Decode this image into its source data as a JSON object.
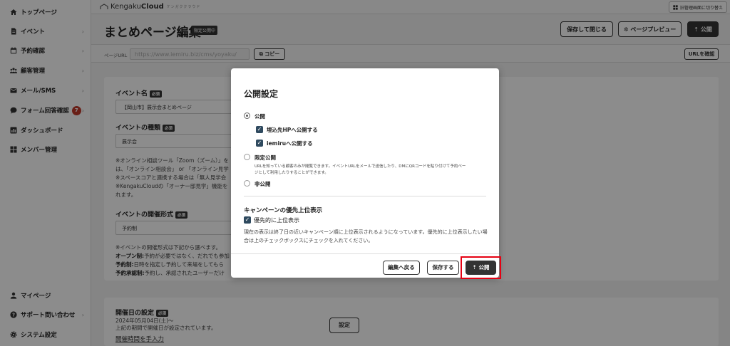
{
  "sidebar": {
    "items": [
      {
        "label": "トップページ",
        "icon": "home-icon",
        "chevron": ""
      },
      {
        "label": "イベント",
        "icon": "document-icon",
        "chevron": "›"
      },
      {
        "label": "予約確認",
        "icon": "calendar-icon",
        "chevron": "›"
      },
      {
        "label": "顧客管理",
        "icon": "people-icon",
        "chevron": "›"
      },
      {
        "label": "メール/SMS",
        "icon": "mail-icon",
        "chevron": "›"
      },
      {
        "label": "フォーム回答確認",
        "icon": "chat-icon",
        "chevron": "›",
        "badge": "7"
      },
      {
        "label": "ダッシュボード",
        "icon": "chart-icon",
        "chevron": ""
      },
      {
        "label": "メンバー管理",
        "icon": "grid-icon",
        "chevron": ""
      }
    ],
    "bottom_items": [
      {
        "label": "マイページ",
        "icon": "user-icon",
        "chevron": ""
      },
      {
        "label": "サポート問い合わせ",
        "icon": "help-icon",
        "chevron": "›"
      },
      {
        "label": "システム設定",
        "icon": "gear-icon",
        "chevron": ""
      }
    ]
  },
  "header": {
    "logo_text": "Kengaku",
    "logo_bold": "Cloud",
    "logo_sub": "ケンガククラウド",
    "admin_switch": "旧管理画面に切り替え",
    "page_title": "まとめページ編集",
    "title_badge": "限定公開中",
    "save_close": "保存して閉じる",
    "preview": "ページプレビュー",
    "publish": "公開"
  },
  "url_row": {
    "label": "ページURL",
    "value": "https://www.iemiru.biz/cms/yoyaku/",
    "copy": "コピー",
    "confirm": "URLを確認"
  },
  "form": {
    "event_name_label": "イベント名",
    "event_name_value": "【岡山市】展示会まとめページ",
    "event_type_label": "イベントの種類",
    "event_type_value": "展示会",
    "required": "必須",
    "notes1": [
      "※オンライン相談ツール「Zoom（ズーム）」を",
      "は、「オンライン相談会」 or 「オンライン見学",
      "※スペースコアと連携する場合は「無人見学会",
      "※KengakuCloudの「オーナー邸見学」機能を",
      "れます。"
    ],
    "format_label": "イベントの開催形式",
    "format_value": "予約制",
    "notes2_intro": "※イベントの開催形式は下記から選べます。",
    "notes2": [
      {
        "b": "オープン制:",
        "t": "予約が必要ではなく、だれでも参加"
      },
      {
        "b": "予約制:",
        "t": "日時を指定し予約して来場をしてもら"
      },
      {
        "b": "予約承認制:",
        "t": "予約し、承認されたユーザーだけ"
      }
    ],
    "date_label": "開催日の設定",
    "date_value": "2024年05月04日(土)～",
    "date_note": "上記の期間で開催日が設定されています。",
    "set_button": "設定",
    "manual_link": "開催時間を手入力"
  },
  "modal": {
    "title": "公開設定",
    "option_public": "公開",
    "check_hp": "埋込先HPへ公開する",
    "check_iemiru": "iemiruへ公開する",
    "option_limited": "限定公開",
    "limited_desc1": "URLを知っている顧客のみが閲覧できます。イベントURLをメールで送信したり、DMにQRコードを貼り付けて予約ペー",
    "limited_desc2": "ジとして利用したりすることができます。",
    "option_private": "非公開",
    "campaign_title": "キャンペーンの優先上位表示",
    "campaign_check": "優先的に上位表示",
    "campaign_desc": "現在の表示は終了日の近いキャンペーン順に上位表示されるようになっています。優先的に上位表示したい場合は上のチェックボックスにチェックを入れてください。",
    "back": "編集へ戻る",
    "save": "保存する",
    "publish": "公開"
  }
}
